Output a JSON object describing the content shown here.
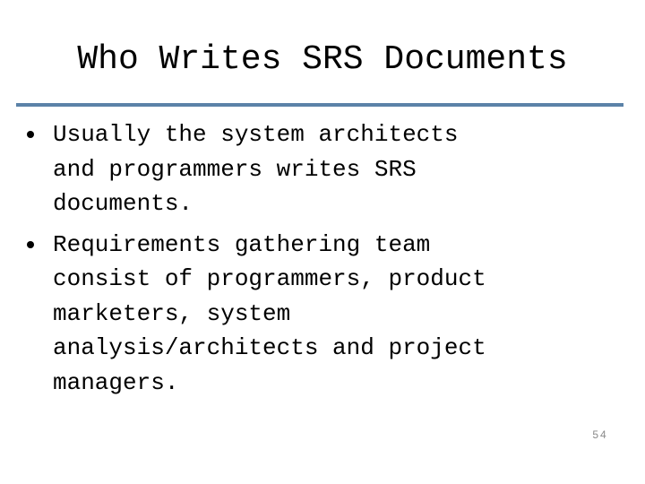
{
  "slide": {
    "title": "Who Writes SRS Documents",
    "accent_color": "#5b82a8",
    "bullets": [
      {
        "text": "Usually the system architects\nand programmers writes SRS\ndocuments."
      },
      {
        "text": "Requirements gathering team\nconsist of programmers, product\nmarketers, system\nanalysis/architects and project\nmanagers."
      }
    ],
    "page_number": "54"
  }
}
